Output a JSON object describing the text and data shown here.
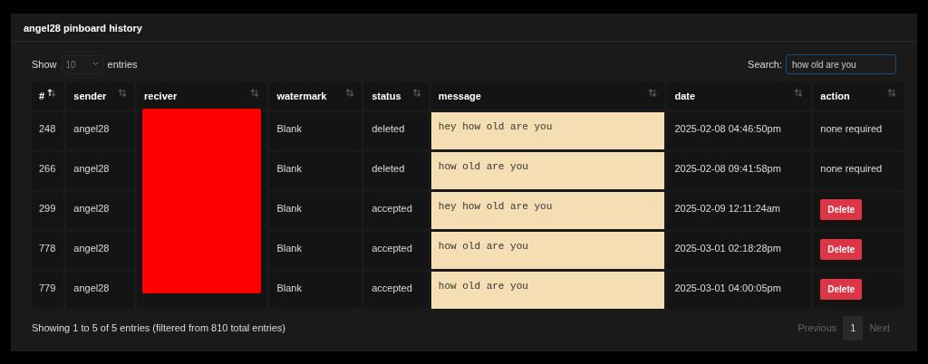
{
  "card": {
    "title": "angel28 pinboard history"
  },
  "length_menu": {
    "label_before": "Show",
    "value": "10",
    "label_after": "entries"
  },
  "search": {
    "label": "Search:",
    "value": "how old are you"
  },
  "table": {
    "receiver_redacted": true,
    "columns": [
      {
        "label": "#",
        "sorted_ascending": true
      },
      {
        "label": "sender",
        "sorted_ascending": false
      },
      {
        "label": "reciver",
        "sorted_ascending": false
      },
      {
        "label": "watermark",
        "sorted_ascending": false
      },
      {
        "label": "status",
        "sorted_ascending": false
      },
      {
        "label": "message",
        "sorted_ascending": false
      },
      {
        "label": "date",
        "sorted_ascending": false
      },
      {
        "label": "action",
        "sorted_ascending": false
      }
    ],
    "rows": [
      {
        "id": "248",
        "sender": "angel28",
        "watermark": "Blank",
        "status": "deleted",
        "message": "hey how old are you",
        "date": "2025-02-08 04:46:50pm",
        "action": {
          "kind": "text",
          "label": "none required"
        }
      },
      {
        "id": "266",
        "sender": "angel28",
        "watermark": "Blank",
        "status": "deleted",
        "message": "how old are you",
        "date": "2025-02-08 09:41:58pm",
        "action": {
          "kind": "text",
          "label": "none required"
        }
      },
      {
        "id": "299",
        "sender": "angel28",
        "watermark": "Blank",
        "status": "accepted",
        "message": "hey how old are you",
        "date": "2025-02-09 12:11:24am",
        "action": {
          "kind": "button",
          "label": "Delete"
        }
      },
      {
        "id": "778",
        "sender": "angel28",
        "watermark": "Blank",
        "status": "accepted",
        "message": "how old are you",
        "date": "2025-03-01 02:18:28pm",
        "action": {
          "kind": "button",
          "label": "Delete"
        }
      },
      {
        "id": "779",
        "sender": "angel28",
        "watermark": "Blank",
        "status": "accepted",
        "message": "how old are you",
        "date": "2025-03-01 04:00:05pm",
        "action": {
          "kind": "button",
          "label": "Delete"
        }
      }
    ]
  },
  "footer": {
    "info": "Showing 1 to 5 of 5 entries (filtered from 810 total entries)",
    "pagination": [
      {
        "label": "Previous",
        "kind": "nav",
        "selected": false
      },
      {
        "label": "1",
        "kind": "page",
        "selected": true
      },
      {
        "label": "Next",
        "kind": "nav",
        "selected": false
      }
    ]
  }
}
